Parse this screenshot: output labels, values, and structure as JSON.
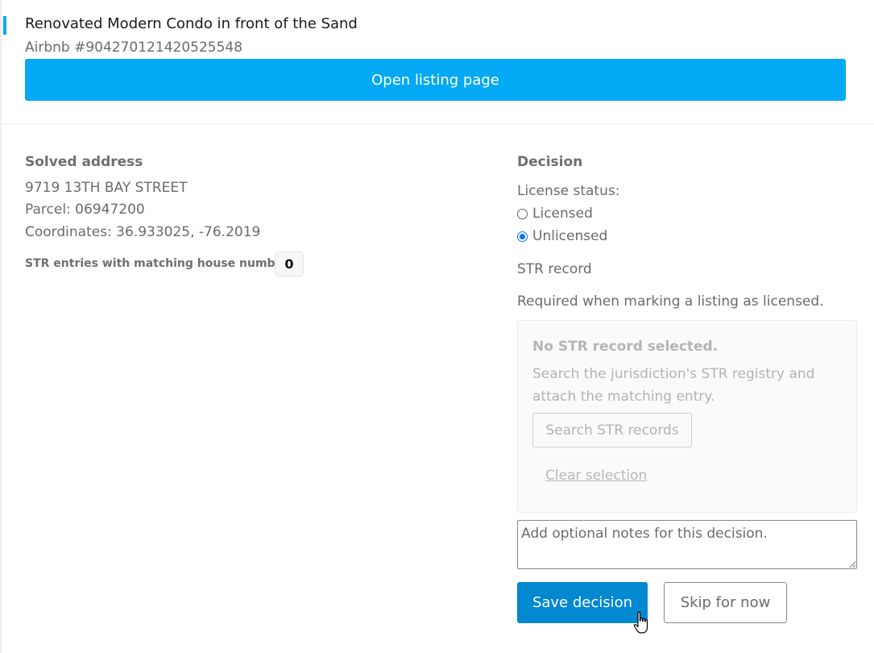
{
  "listing": {
    "title": "Renovated Modern Condo in front of the Sand",
    "id_text": "Airbnb #904270121420525548",
    "open_button_label": "Open listing page"
  },
  "address": {
    "heading": "Solved address",
    "street": "9719 13TH BAY STREET",
    "parcel": "Parcel: 06947200",
    "coordinates": "Coordinates: 36.933025, -76.2019",
    "match_label": "STR entries with matching house number:",
    "match_count": "0"
  },
  "decision": {
    "heading": "Decision",
    "license_status_label": "License status:",
    "options": [
      {
        "label": "Licensed",
        "selected": false
      },
      {
        "label": "Unlicensed",
        "selected": true
      }
    ],
    "str_record_label": "STR record",
    "str_required_note": "Required when marking a listing as licensed.",
    "str_panel": {
      "title": "No STR record selected.",
      "description": "Search the jurisdiction's STR registry and attach the matching entry.",
      "search_button_label": "Search STR records",
      "clear_label": "Clear selection"
    },
    "notes_placeholder": "Add optional notes for this decision.",
    "save_label": "Save decision",
    "skip_label": "Skip for now"
  },
  "colors": {
    "accent": "#03a9f4",
    "primary_button": "#0288d1",
    "radio_selected": "#0075ff"
  }
}
